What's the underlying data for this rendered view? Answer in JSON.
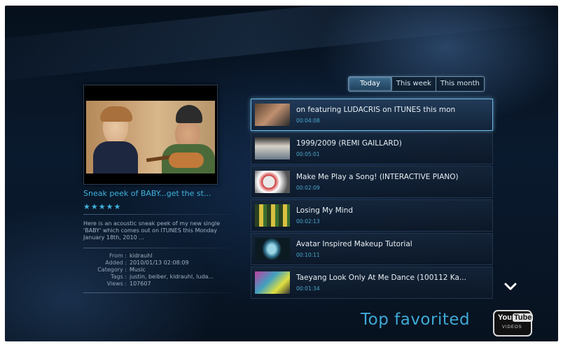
{
  "filters": {
    "tabs": [
      {
        "label": "Today",
        "active": true
      },
      {
        "label": "This week",
        "active": false
      },
      {
        "label": "This month",
        "active": false
      }
    ]
  },
  "preview": {
    "title": "Sneak peek of BABY...get the st...",
    "rating": "★★★★★",
    "description": "Here is an acoustic sneak peek of my new single 'BABY' which comes out on ITUNES this Monday January 18th, 2010 ...",
    "meta": [
      {
        "label": "From :",
        "value": "kidrauhl"
      },
      {
        "label": "Added :",
        "value": "2010/01/13 02:08:09"
      },
      {
        "label": "Category :",
        "value": "Music"
      },
      {
        "label": "Tags :",
        "value": "justin, beiber, kidrauhl, luda..."
      },
      {
        "label": "Views :",
        "value": "107607"
      }
    ]
  },
  "videos": [
    {
      "title": "on featuring LUDACRIS on ITUNES this mon",
      "duration": "00:04:08",
      "thumb": "t1",
      "selected": true
    },
    {
      "title": "1999/2009 (REMI GAILLARD)",
      "duration": "00:05:01",
      "thumb": "t2",
      "selected": false
    },
    {
      "title": "Make Me Play a Song! (INTERACTIVE PIANO)",
      "duration": "00:02:09",
      "thumb": "t3",
      "selected": false
    },
    {
      "title": "Losing My Mind",
      "duration": "00:02:13",
      "thumb": "t4",
      "selected": false
    },
    {
      "title": "Avatar Inspired Makeup Tutorial",
      "duration": "00:10:11",
      "thumb": "t5",
      "selected": false
    },
    {
      "title": "Taeyang Look Only At Me Dance (100112 Ka...",
      "duration": "00:01:34",
      "thumb": "t6",
      "selected": false
    }
  ],
  "footer": {
    "section_title": "Top favorited",
    "logo_top_left": "You",
    "logo_top_right": "Tube",
    "logo_bottom": "VIDEOS"
  },
  "icons": {
    "scroll_down": "chevron-down-icon"
  },
  "colors": {
    "accent": "#3fa9d6",
    "background": "#0a1a2e"
  }
}
